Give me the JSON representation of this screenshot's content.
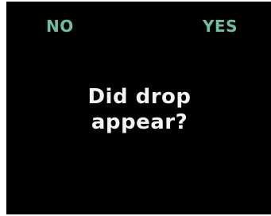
{
  "softkeys": {
    "left_label": "NO",
    "right_label": "YES",
    "color": "#6fbfa6"
  },
  "prompt": {
    "line1": "Did drop",
    "line2": "appear?",
    "color": "#f2f2f2"
  },
  "screen": {
    "background": "#000000"
  }
}
